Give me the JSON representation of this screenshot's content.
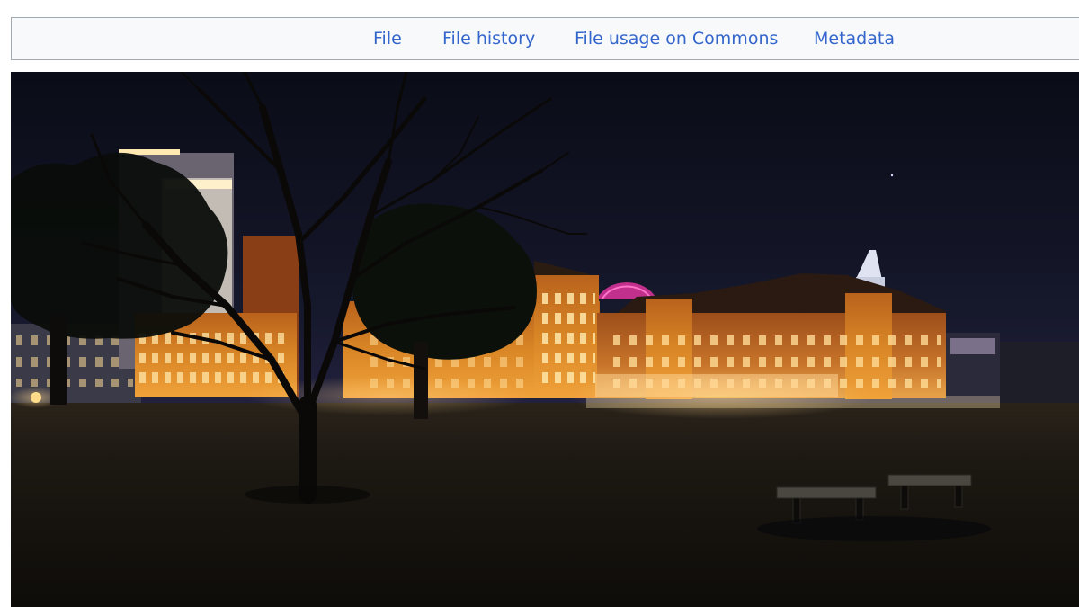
{
  "tabs": [
    {
      "label": "File"
    },
    {
      "label": "File history"
    },
    {
      "label": "File usage on Commons"
    },
    {
      "label": "Metadata"
    }
  ],
  "colors": {
    "link": "#3366cc",
    "tabbar_background": "#f8f9fa",
    "tabbar_border": "#a2a9b1"
  },
  "image": {
    "subject": "night-photo-brick-warehouses-with-trees-and-benches"
  }
}
